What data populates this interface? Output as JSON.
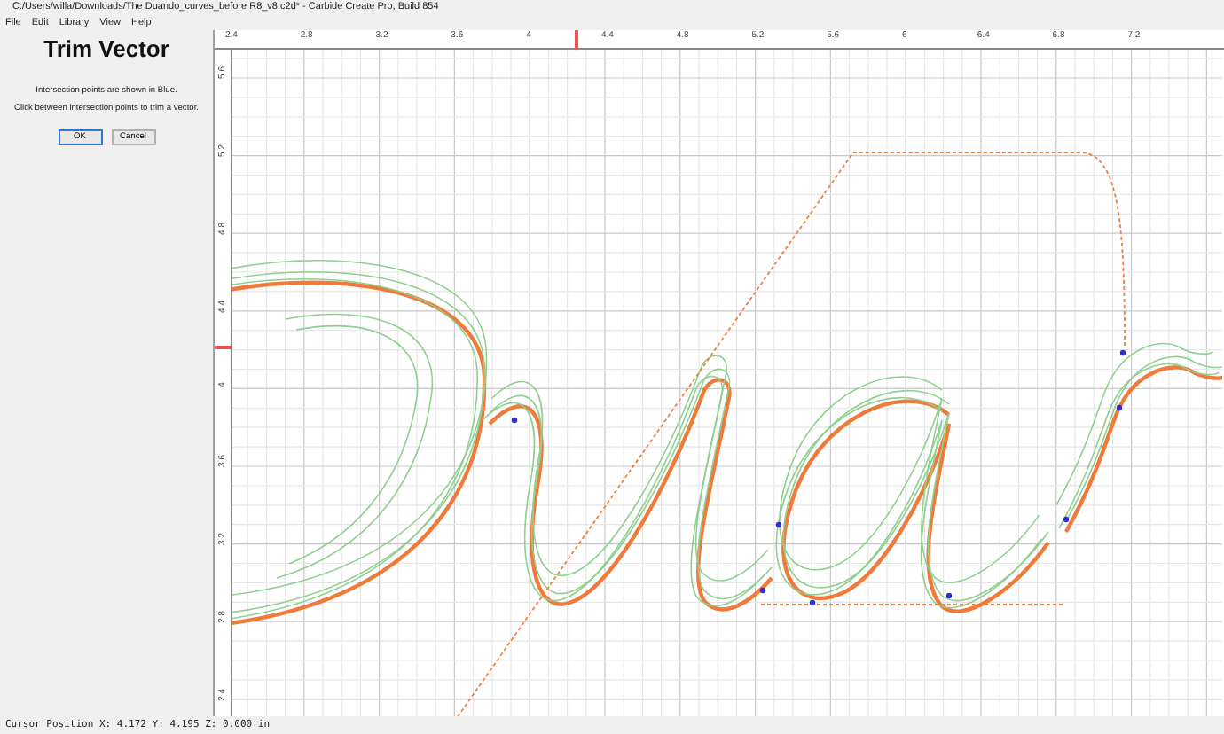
{
  "window": {
    "title": "C:/Users/willa/Downloads/The Duando_curves_before R8_v8.c2d* - Carbide Create Pro, Build 854"
  },
  "menu": [
    "File",
    "Edit",
    "Library",
    "View",
    "Help"
  ],
  "panel": {
    "title": "Trim Vector",
    "instructions": [
      "Intersection points are shown in Blue.",
      "Click between intersection points to trim a vector."
    ],
    "buttons": [
      {
        "label": "OK",
        "default": true
      },
      {
        "label": "Cancel",
        "default": false
      }
    ]
  },
  "rulers": {
    "horizontal": [
      "2.4",
      "2.8",
      "3.2",
      "3.6",
      "4",
      "4.4",
      "4.8",
      "5.2",
      "5.6",
      "6",
      "6.4",
      "6.8",
      "7.2"
    ],
    "vertical": [
      "5.6",
      "5.2",
      "4.8",
      "4.4",
      "4",
      "3.6",
      "3.2",
      "2.8",
      "2.4"
    ]
  },
  "status_bar": "Cursor Position X: 4.172 Y: 4.195 Z: 0.000 in"
}
